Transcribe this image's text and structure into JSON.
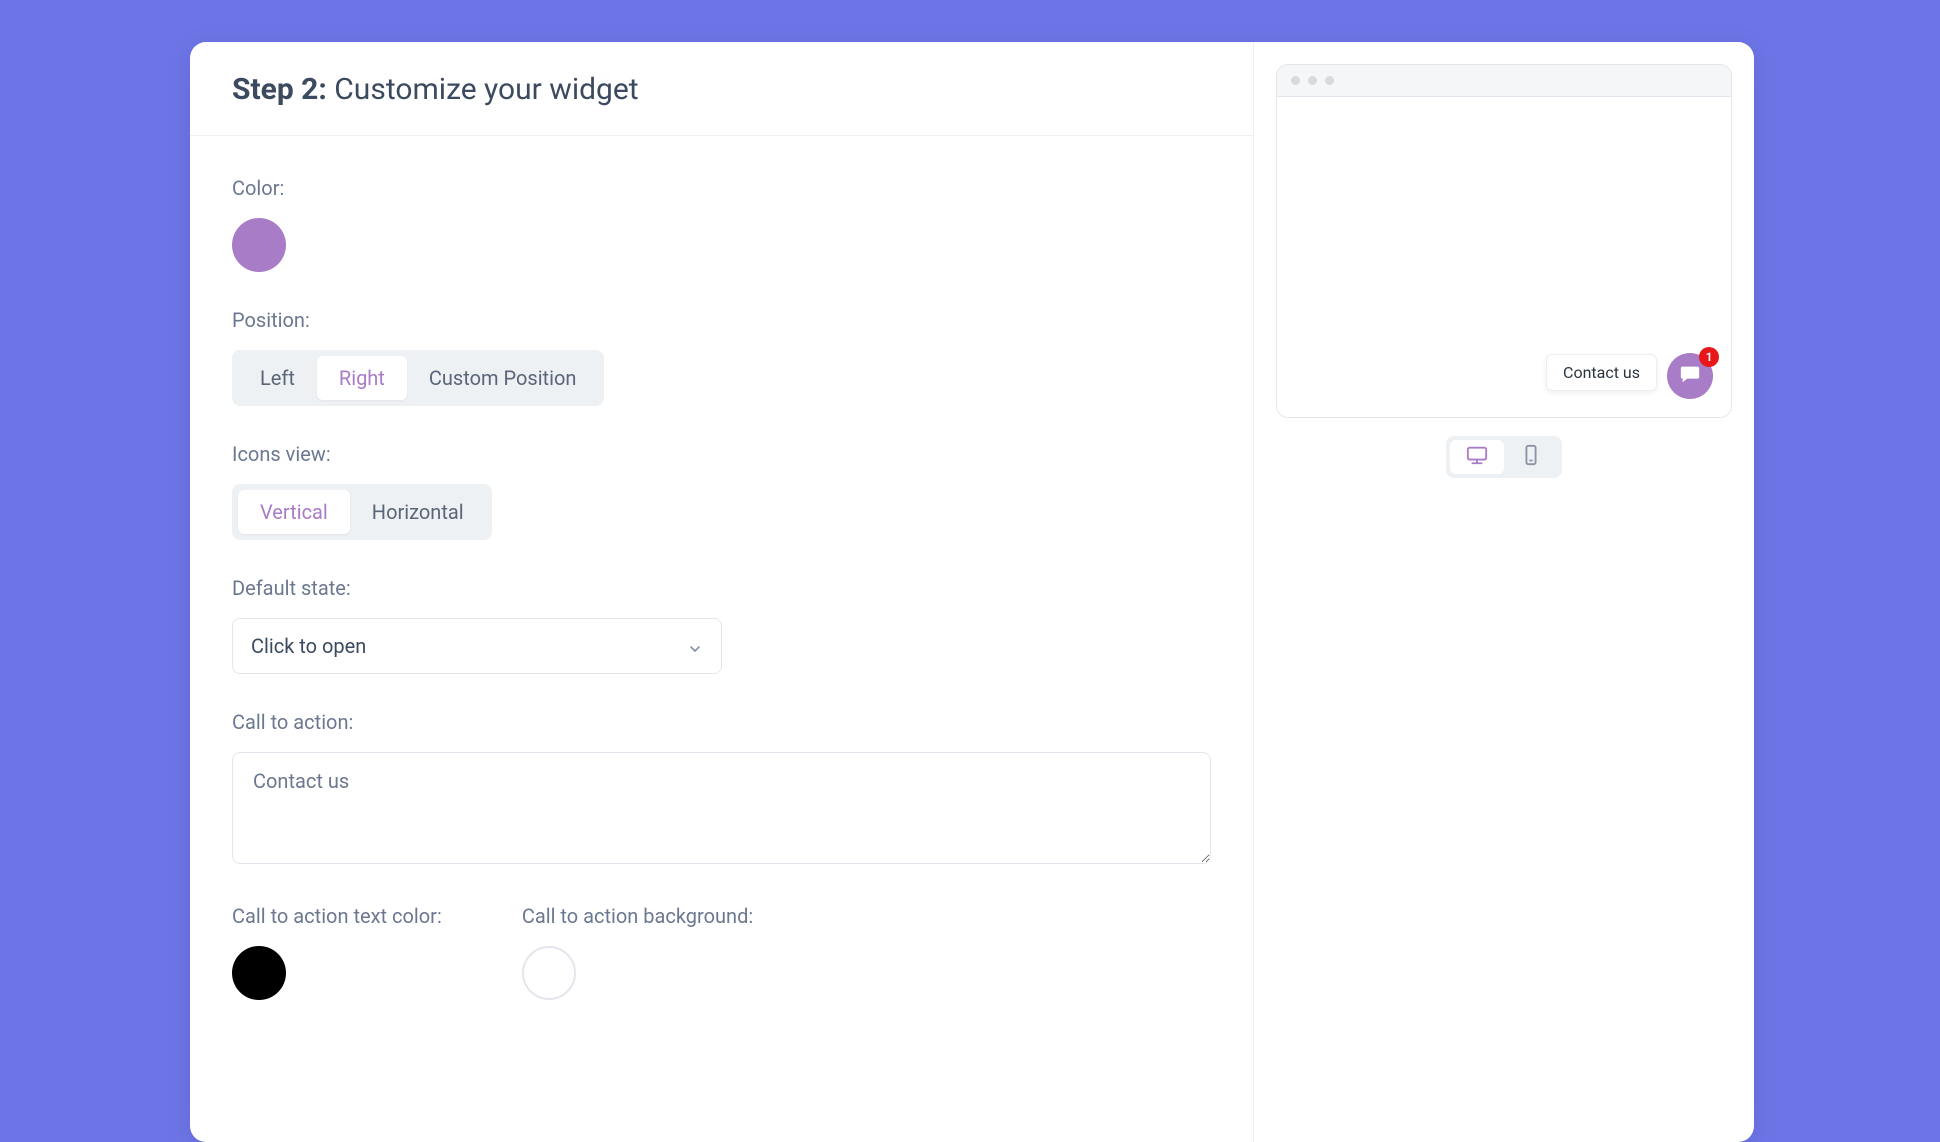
{
  "header": {
    "step_prefix": "Step 2:",
    "title": "Customize your widget"
  },
  "form": {
    "color": {
      "label": "Color:",
      "value": "#a97cc8"
    },
    "position": {
      "label": "Position:",
      "options": [
        "Left",
        "Right",
        "Custom Position"
      ],
      "selected": "Right"
    },
    "icons_view": {
      "label": "Icons view:",
      "options": [
        "Vertical",
        "Horizontal"
      ],
      "selected": "Vertical"
    },
    "default_state": {
      "label": "Default state:",
      "value": "Click to open"
    },
    "cta": {
      "label": "Call to action:",
      "value": "Contact us"
    },
    "cta_text_color": {
      "label": "Call to action text color:",
      "value": "#000000"
    },
    "cta_bg": {
      "label": "Call to action background:",
      "value": "#ffffff"
    }
  },
  "preview": {
    "cta_text": "Contact us",
    "badge_count": "1",
    "device_selected": "desktop"
  }
}
